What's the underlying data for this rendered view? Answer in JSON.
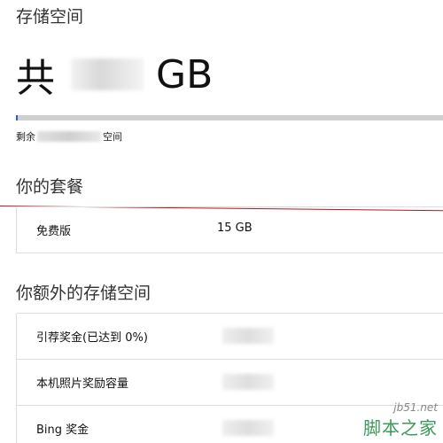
{
  "storage": {
    "section_title": "存储空间",
    "total_prefix": "共",
    "total_unit": "GB",
    "usage_fraction": 0.0,
    "remaining_prefix": "剩余",
    "remaining_suffix": "空间",
    "progress_color": "#2b66b3"
  },
  "plan": {
    "section_title": "你的套餐",
    "rows": [
      {
        "label": "免费版",
        "value": "15 GB"
      }
    ]
  },
  "extra": {
    "section_title": "你额外的存储空间",
    "rows": [
      {
        "label": "引荐奖金(已达到 0%)"
      },
      {
        "label": "本机照片奖励容量"
      },
      {
        "label": "Bing 奖金"
      }
    ]
  },
  "watermark": {
    "site": "jb51.net",
    "name": "脚本之家"
  }
}
